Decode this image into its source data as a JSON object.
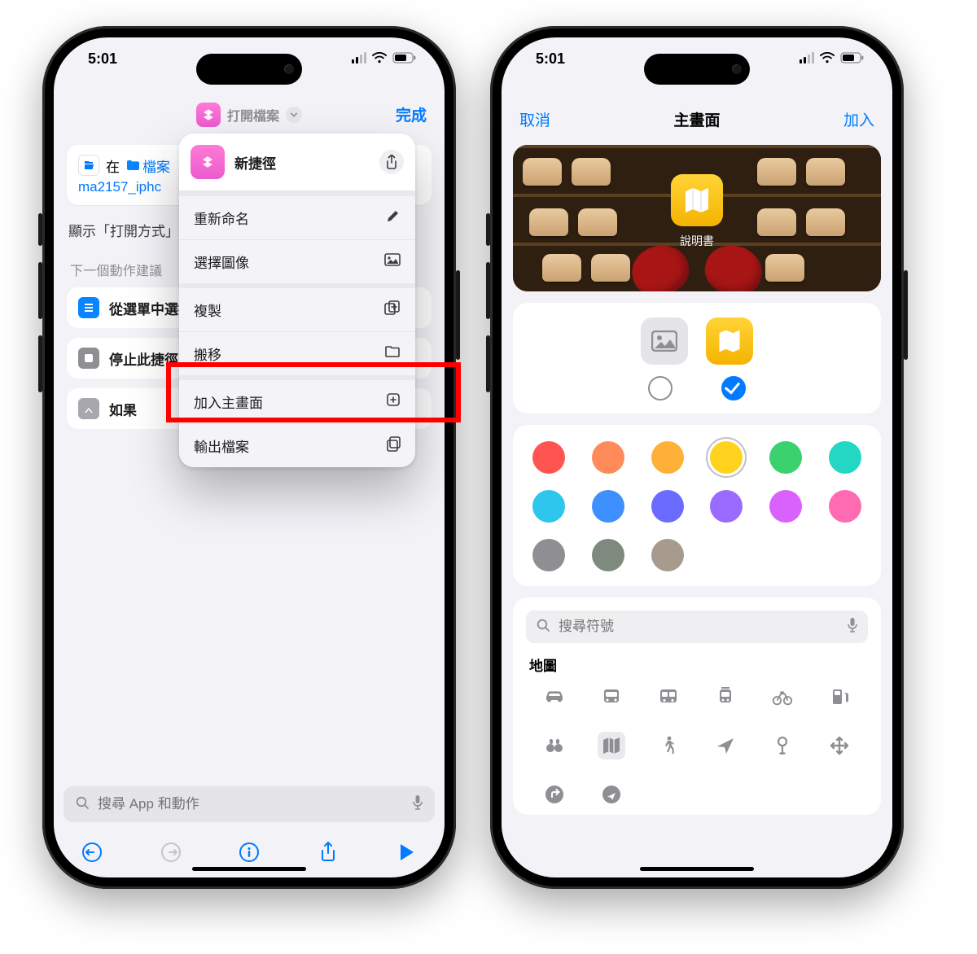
{
  "status": {
    "time": "5:01"
  },
  "phone1": {
    "header": {
      "title": "打開檔案",
      "done": "完成"
    },
    "openCard": {
      "prefix": "在",
      "folderName": "檔案",
      "filename": "ma2157_iphc"
    },
    "showRow": "顯示「打開方式」",
    "nextSuggestions": "下一個動作建議",
    "sugg": [
      "從選單中選擇",
      "停止此捷徑",
      "如果"
    ],
    "dropdown": {
      "title": "新捷徑",
      "items": [
        "重新命名",
        "選擇圖像",
        "複製",
        "搬移",
        "加入主畫面",
        "輸出檔案"
      ]
    },
    "search": {
      "placeholder": "搜尋 App 和動作"
    }
  },
  "phone2": {
    "header": {
      "cancel": "取消",
      "title": "主畫面",
      "add": "加入"
    },
    "preview": {
      "iconLabel": "說明書"
    },
    "colors": [
      "#ff5452",
      "#ff8a5a",
      "#ffb038",
      "#ffd21e",
      "#3bd16f",
      "#24d6c4",
      "#2fc6ed",
      "#3e90ff",
      "#6b6cff",
      "#9b6bff",
      "#d962ff",
      "#ff6bb0",
      "#8e8e93",
      "#7d8a7d",
      "#a79b8d"
    ],
    "selectedColorIndex": 3,
    "glyphSearch": {
      "placeholder": "搜尋符號"
    },
    "glyphCategory": "地圖"
  }
}
